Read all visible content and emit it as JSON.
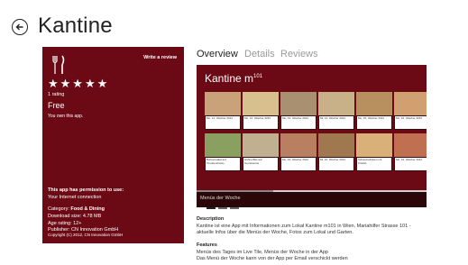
{
  "header": {
    "title": "Kantine"
  },
  "panel": {
    "write_review": "Write a review",
    "stars": "★★★★★",
    "rating": "1 rating",
    "price": "Free",
    "owned": "You own this app.",
    "permissions_title": "This app has permission to use:",
    "permissions": [
      "Your Internet connection"
    ],
    "category_label": "Category:",
    "category_value": "Food & Dining",
    "download_size": "Download size: 4.78 MB",
    "age_rating": "Age rating: 12+",
    "publisher": "Publisher: CN Innovation GmbH",
    "copyright": "Copyright (C) 2012, CN Innovation GmbH"
  },
  "tabs": [
    {
      "label": "Overview",
      "active": true
    },
    {
      "label": "Details",
      "active": false
    },
    {
      "label": "Reviews",
      "active": false
    }
  ],
  "screenshot": {
    "app_title": "Kantine m",
    "app_title_sup": "101",
    "caption": "Menüs der Woche",
    "tiles": [
      {
        "caption": "Mo, 12. Oktober 2012"
      },
      {
        "caption": "Mo, 12. Oktober 2012"
      },
      {
        "caption": "Mo, 13. Oktober 2012"
      },
      {
        "caption": "Mi, 13. Oktober 2012"
      },
      {
        "caption": "Mo, 15. Oktober 2012"
      },
      {
        "caption": "Mo, 16. Oktober 2012"
      },
      {
        "caption": "Bohnensalat auf Tomatenrisotto"
      },
      {
        "caption": "Hühnerfilet auf Gemüsereis"
      },
      {
        "caption": "Mo, 19. Oktober 2012"
      },
      {
        "caption": "Mi, 16. Oktober 2012"
      },
      {
        "caption": "Schweinebraten mit Knödel"
      },
      {
        "caption": "Mo, 19. Oktober 2012"
      }
    ]
  },
  "description": {
    "heading": "Description",
    "lines": [
      "Kantine ist eine App mit Informationen zum Lokal Kantine m101 in Wien, Mariahilfer Strasse 101 -",
      "aktuelle Infos über die Menüs der Woche, Fotos zum Lokal und Garten."
    ]
  },
  "features": {
    "heading": "Features",
    "lines": [
      "Menüs des Tages im Live Tile, Menüs der Woche in der App",
      "Das Menü der Woche kann von der App per Email verschickt werden"
    ]
  },
  "colors": {
    "panel": "#6b0a14",
    "background": "#ffffff"
  }
}
